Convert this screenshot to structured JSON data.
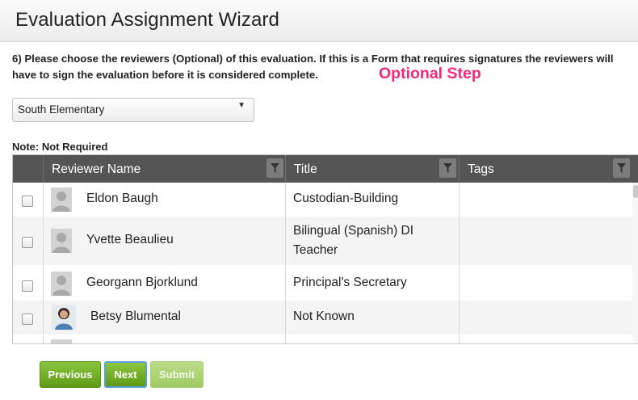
{
  "header": {
    "title": "Evaluation Assignment Wizard"
  },
  "instructions": {
    "text": "6) Please choose the reviewers (Optional) of this evaluation. If this is a Form that requires signatures the reviewers will have to sign the evaluation before it is considered complete.",
    "optional_label": "Optional Step"
  },
  "school_select": {
    "value": "South Elementary"
  },
  "note": "Note: Not Required",
  "grid": {
    "columns": [
      "Reviewer Name",
      "Title",
      "Tags"
    ],
    "rows": [
      {
        "name": "Eldon Baugh",
        "title": "Custodian-Building",
        "tags": "",
        "checked": false,
        "avatar": "placeholder-avatar"
      },
      {
        "name": "Yvette Beaulieu",
        "title": "Bilingual (Spanish) DI Teacher",
        "tags": "",
        "checked": false,
        "avatar": "placeholder-avatar"
      },
      {
        "name": "Georgann Bjorklund",
        "title": "Principal's Secretary",
        "tags": "",
        "checked": false,
        "avatar": "placeholder-avatar"
      },
      {
        "name": "Betsy Blumental",
        "title": "Not Known",
        "tags": "",
        "checked": false,
        "avatar": "photo-avatar"
      }
    ]
  },
  "buttons": {
    "previous": "Previous",
    "next": "Next",
    "submit": "Submit"
  },
  "colors": {
    "optional_accent": "#ee2a7b",
    "button_green": "#6aa824",
    "grid_header": "#555555"
  }
}
